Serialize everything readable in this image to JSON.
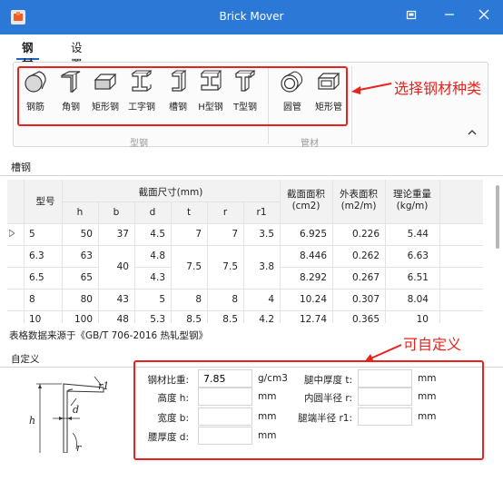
{
  "window": {
    "title": "Brick Mover",
    "icon": "brick-icon",
    "controls": [
      "restore-icon",
      "minimize-icon",
      "close-icon"
    ]
  },
  "tabs": [
    {
      "label": "钢材",
      "active": true
    },
    {
      "label": "设置",
      "active": false
    }
  ],
  "ribbon": {
    "groups": [
      {
        "label": "型钢",
        "items": [
          "钢筋",
          "角钢",
          "矩形钢",
          "工字钢",
          "槽钢",
          "H型钢",
          "T型钢"
        ]
      },
      {
        "label": "管材",
        "items": [
          "圆管",
          "矩形管"
        ]
      }
    ],
    "collapse_icon": "chevron-up-icon"
  },
  "annotations": {
    "select_type": "选择钢材种类",
    "customizable": "可自定义"
  },
  "section": {
    "title": "槽钢"
  },
  "table": {
    "headers": {
      "model": "型号",
      "dims_group": "截面尺寸(mm)",
      "dims": [
        "h",
        "b",
        "d",
        "t",
        "r",
        "r1"
      ],
      "area": [
        "截面面积",
        "(cm2)"
      ],
      "surface": [
        "外表面积",
        "(m2/m)"
      ],
      "weight": [
        "理论重量",
        "(kg/m)"
      ]
    },
    "rows": [
      {
        "model": "5",
        "h": "50",
        "b": "37",
        "d": "4.5",
        "t": "7",
        "r": "7",
        "r1": "3.5",
        "area": "6.925",
        "surface": "0.226",
        "weight": "5.44",
        "current": true
      },
      {
        "model": "6.3",
        "h": "63",
        "b": "",
        "d": "4.8",
        "t": "",
        "r": "",
        "r1": "",
        "area": "8.446",
        "surface": "0.262",
        "weight": "6.63"
      },
      {
        "model": "6.5",
        "h": "65",
        "b": "",
        "d": "4.3",
        "t": "",
        "r": "",
        "r1": "",
        "area": "8.292",
        "surface": "0.267",
        "weight": "6.51"
      },
      {
        "model": "8",
        "h": "80",
        "b": "43",
        "d": "5",
        "t": "8",
        "r": "8",
        "r1": "4",
        "area": "10.24",
        "surface": "0.307",
        "weight": "8.04"
      },
      {
        "model": "10",
        "h": "100",
        "b": "48",
        "d": "5.3",
        "t": "8.5",
        "r": "8.5",
        "r1": "4.2",
        "area": "12.74",
        "surface": "0.365",
        "weight": "10"
      }
    ],
    "merged": {
      "b_63_65": "40",
      "t_63_65": "7.5",
      "r_63_65": "7.5",
      "r1_63_65": "3.8"
    },
    "current_row_icon": "triangle-right-icon"
  },
  "source_note": "表格数据来源于《GB/T 706-2016 热轧型钢》",
  "custom": {
    "title": "自定义",
    "diagram_labels": {
      "r1": "r1",
      "h": "h",
      "d": "d",
      "r": "r"
    },
    "fields": [
      {
        "label": "钢材比重:",
        "value": "7.85",
        "unit": "g/cm3"
      },
      {
        "label": "高度 h:",
        "value": "",
        "unit": "mm"
      },
      {
        "label": "宽度 b:",
        "value": "",
        "unit": "mm"
      },
      {
        "label": "腰厚度 d:",
        "value": "",
        "unit": "mm"
      },
      {
        "label": "腿中厚度 t:",
        "value": "",
        "unit": "mm"
      },
      {
        "label": "内圆半径 r:",
        "value": "",
        "unit": "mm"
      },
      {
        "label": "腿端半径 r1:",
        "value": "",
        "unit": "mm"
      }
    ]
  },
  "colors": {
    "titlebar": "#2b78d6",
    "accent": "#1f64c4",
    "annotation": "#e8231d"
  }
}
